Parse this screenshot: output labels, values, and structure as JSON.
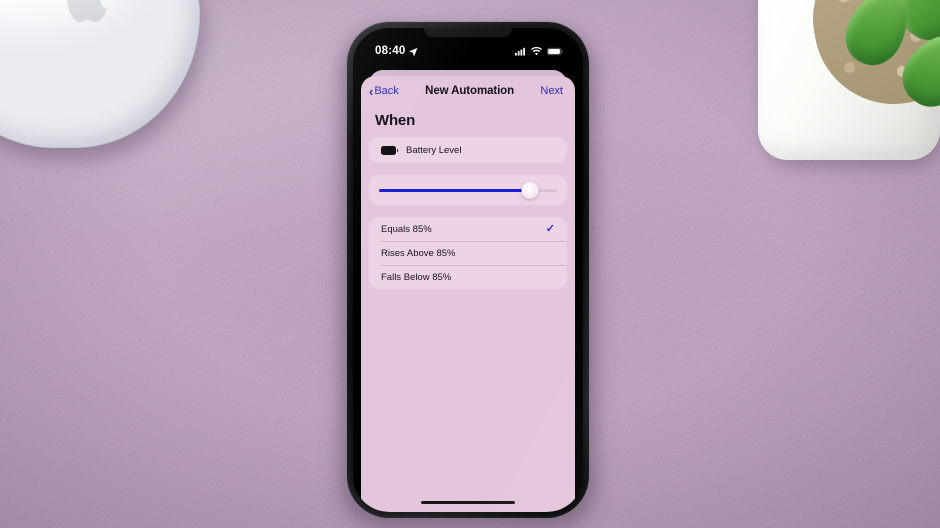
{
  "scene": {
    "surface_color": "#c2a8c3",
    "objects": [
      "magic-mouse",
      "succulent-plant",
      "iphone"
    ]
  },
  "phone": {
    "status_bar": {
      "time": "08:40",
      "location_icon": "location-arrow-icon",
      "cellular_icon": "cellular-bars-icon",
      "wifi_icon": "wifi-icon",
      "battery_icon": "battery-icon"
    },
    "screen_bg": "#e3c5dc",
    "accent_color": "#2b2bc4"
  },
  "navbar": {
    "back_label": "Back",
    "back_icon": "chevron-left-icon",
    "title": "New Automation",
    "next_label": "Next"
  },
  "content": {
    "section_title": "When",
    "trigger": {
      "icon": "battery-icon",
      "label": "Battery Level"
    },
    "slider": {
      "value": 85,
      "min": 0,
      "max": 100,
      "fill_color": "#1a1ad6",
      "track_color": "#dcc0d6"
    },
    "options": [
      {
        "label": "Equals 85%",
        "selected": true,
        "check_icon": "checkmark-icon"
      },
      {
        "label": "Rises Above 85%",
        "selected": false,
        "check_icon": "checkmark-icon"
      },
      {
        "label": "Falls Below 85%",
        "selected": false,
        "check_icon": "checkmark-icon"
      }
    ]
  }
}
